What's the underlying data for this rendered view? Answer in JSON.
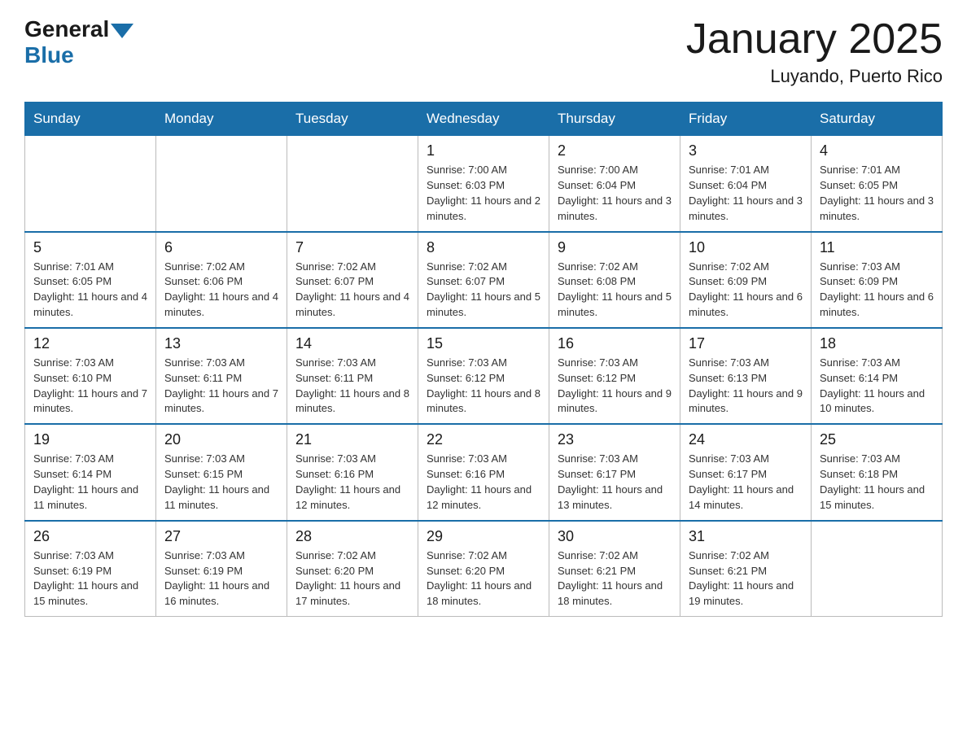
{
  "header": {
    "logo_general": "General",
    "logo_blue": "Blue",
    "title": "January 2025",
    "subtitle": "Luyando, Puerto Rico"
  },
  "days_of_week": [
    "Sunday",
    "Monday",
    "Tuesday",
    "Wednesday",
    "Thursday",
    "Friday",
    "Saturday"
  ],
  "weeks": [
    [
      {
        "day": "",
        "info": ""
      },
      {
        "day": "",
        "info": ""
      },
      {
        "day": "",
        "info": ""
      },
      {
        "day": "1",
        "info": "Sunrise: 7:00 AM\nSunset: 6:03 PM\nDaylight: 11 hours and 2 minutes."
      },
      {
        "day": "2",
        "info": "Sunrise: 7:00 AM\nSunset: 6:04 PM\nDaylight: 11 hours and 3 minutes."
      },
      {
        "day": "3",
        "info": "Sunrise: 7:01 AM\nSunset: 6:04 PM\nDaylight: 11 hours and 3 minutes."
      },
      {
        "day": "4",
        "info": "Sunrise: 7:01 AM\nSunset: 6:05 PM\nDaylight: 11 hours and 3 minutes."
      }
    ],
    [
      {
        "day": "5",
        "info": "Sunrise: 7:01 AM\nSunset: 6:05 PM\nDaylight: 11 hours and 4 minutes."
      },
      {
        "day": "6",
        "info": "Sunrise: 7:02 AM\nSunset: 6:06 PM\nDaylight: 11 hours and 4 minutes."
      },
      {
        "day": "7",
        "info": "Sunrise: 7:02 AM\nSunset: 6:07 PM\nDaylight: 11 hours and 4 minutes."
      },
      {
        "day": "8",
        "info": "Sunrise: 7:02 AM\nSunset: 6:07 PM\nDaylight: 11 hours and 5 minutes."
      },
      {
        "day": "9",
        "info": "Sunrise: 7:02 AM\nSunset: 6:08 PM\nDaylight: 11 hours and 5 minutes."
      },
      {
        "day": "10",
        "info": "Sunrise: 7:02 AM\nSunset: 6:09 PM\nDaylight: 11 hours and 6 minutes."
      },
      {
        "day": "11",
        "info": "Sunrise: 7:03 AM\nSunset: 6:09 PM\nDaylight: 11 hours and 6 minutes."
      }
    ],
    [
      {
        "day": "12",
        "info": "Sunrise: 7:03 AM\nSunset: 6:10 PM\nDaylight: 11 hours and 7 minutes."
      },
      {
        "day": "13",
        "info": "Sunrise: 7:03 AM\nSunset: 6:11 PM\nDaylight: 11 hours and 7 minutes."
      },
      {
        "day": "14",
        "info": "Sunrise: 7:03 AM\nSunset: 6:11 PM\nDaylight: 11 hours and 8 minutes."
      },
      {
        "day": "15",
        "info": "Sunrise: 7:03 AM\nSunset: 6:12 PM\nDaylight: 11 hours and 8 minutes."
      },
      {
        "day": "16",
        "info": "Sunrise: 7:03 AM\nSunset: 6:12 PM\nDaylight: 11 hours and 9 minutes."
      },
      {
        "day": "17",
        "info": "Sunrise: 7:03 AM\nSunset: 6:13 PM\nDaylight: 11 hours and 9 minutes."
      },
      {
        "day": "18",
        "info": "Sunrise: 7:03 AM\nSunset: 6:14 PM\nDaylight: 11 hours and 10 minutes."
      }
    ],
    [
      {
        "day": "19",
        "info": "Sunrise: 7:03 AM\nSunset: 6:14 PM\nDaylight: 11 hours and 11 minutes."
      },
      {
        "day": "20",
        "info": "Sunrise: 7:03 AM\nSunset: 6:15 PM\nDaylight: 11 hours and 11 minutes."
      },
      {
        "day": "21",
        "info": "Sunrise: 7:03 AM\nSunset: 6:16 PM\nDaylight: 11 hours and 12 minutes."
      },
      {
        "day": "22",
        "info": "Sunrise: 7:03 AM\nSunset: 6:16 PM\nDaylight: 11 hours and 12 minutes."
      },
      {
        "day": "23",
        "info": "Sunrise: 7:03 AM\nSunset: 6:17 PM\nDaylight: 11 hours and 13 minutes."
      },
      {
        "day": "24",
        "info": "Sunrise: 7:03 AM\nSunset: 6:17 PM\nDaylight: 11 hours and 14 minutes."
      },
      {
        "day": "25",
        "info": "Sunrise: 7:03 AM\nSunset: 6:18 PM\nDaylight: 11 hours and 15 minutes."
      }
    ],
    [
      {
        "day": "26",
        "info": "Sunrise: 7:03 AM\nSunset: 6:19 PM\nDaylight: 11 hours and 15 minutes."
      },
      {
        "day": "27",
        "info": "Sunrise: 7:03 AM\nSunset: 6:19 PM\nDaylight: 11 hours and 16 minutes."
      },
      {
        "day": "28",
        "info": "Sunrise: 7:02 AM\nSunset: 6:20 PM\nDaylight: 11 hours and 17 minutes."
      },
      {
        "day": "29",
        "info": "Sunrise: 7:02 AM\nSunset: 6:20 PM\nDaylight: 11 hours and 18 minutes."
      },
      {
        "day": "30",
        "info": "Sunrise: 7:02 AM\nSunset: 6:21 PM\nDaylight: 11 hours and 18 minutes."
      },
      {
        "day": "31",
        "info": "Sunrise: 7:02 AM\nSunset: 6:21 PM\nDaylight: 11 hours and 19 minutes."
      },
      {
        "day": "",
        "info": ""
      }
    ]
  ]
}
